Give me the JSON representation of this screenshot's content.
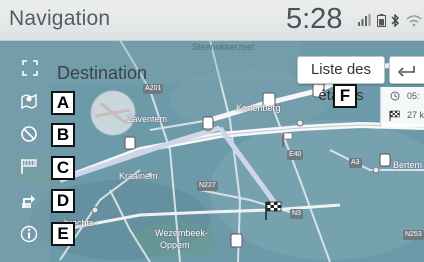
{
  "header": {
    "title": "Navigation",
    "clock": "5:28"
  },
  "colors": {
    "sidebar": "#66929f",
    "route": "#cfd6ea",
    "accent": "#e6e9ea"
  },
  "map": {
    "places": {
      "steenokkerzeel": "Steenokkerzeel",
      "zaventem": "Zaventem",
      "kortenberg": "Kortenberg",
      "kraainem": "Kraainem",
      "bertem": "Bertem",
      "brechts": "brechts-",
      "wezembeek": "Wezembeek-",
      "oppem": "Oppem"
    },
    "roads": {
      "a201": "A201",
      "e40": "E40",
      "a3": "A3",
      "n227": "N227",
      "n3": "N3",
      "n253": "N253"
    }
  },
  "menu": {
    "destination_label": "Destination",
    "items": [
      {
        "letter": "A",
        "icon": "map-pin-icon"
      },
      {
        "letter": "B",
        "icon": "cancel-route-icon"
      },
      {
        "letter": "C",
        "icon": "route-flag-icon"
      },
      {
        "letter": "D",
        "icon": "detour-icon"
      },
      {
        "letter": "E",
        "icon": "info-icon"
      }
    ]
  },
  "toolbar": {
    "list_label": "Liste des étapes",
    "list_letter": "F",
    "back_icon": "back-arrow-icon"
  },
  "route_info": {
    "time": "05:",
    "distance": "27 k"
  }
}
